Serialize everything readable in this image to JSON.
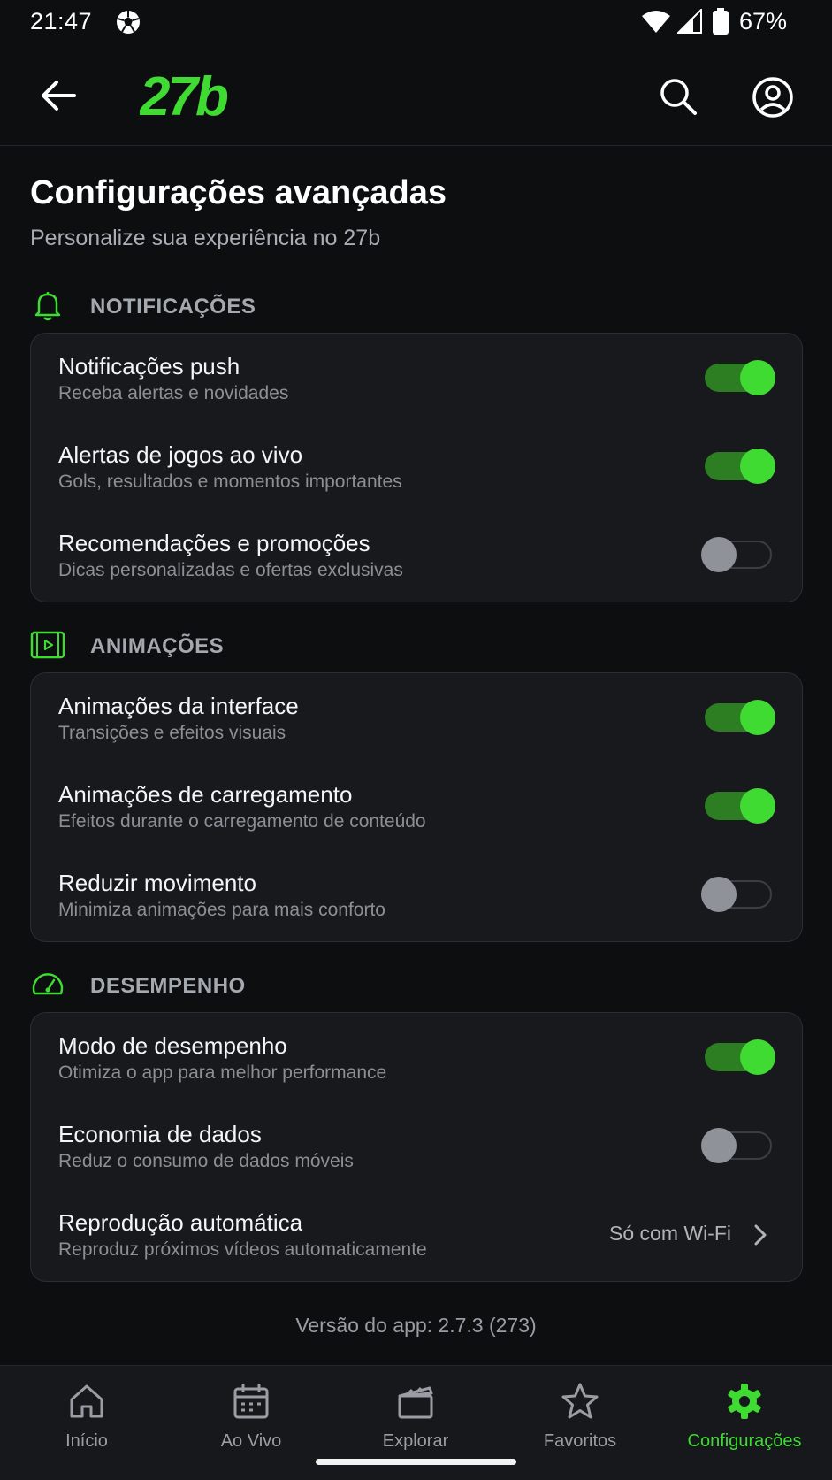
{
  "status_bar": {
    "time": "21:47",
    "battery": "67%"
  },
  "app_bar": {
    "logo_text": "27b"
  },
  "header": {
    "title": "Configurações avançadas",
    "subtitle": "Personalize sua experiência no 27b"
  },
  "sections": {
    "notifications": {
      "label": "NOTIFICAÇÕES",
      "rows": [
        {
          "title": "Notificações push",
          "desc": "Receba alertas e novidades",
          "enabled": true
        },
        {
          "title": "Alertas de jogos ao vivo",
          "desc": "Gols, resultados e momentos importantes",
          "enabled": true
        },
        {
          "title": "Recomendações e promoções",
          "desc": "Dicas personalizadas e ofertas exclusivas",
          "enabled": false
        }
      ]
    },
    "animations": {
      "label": "ANIMAÇÕES",
      "rows": [
        {
          "title": "Animações da interface",
          "desc": "Transições e efeitos visuais",
          "enabled": true
        },
        {
          "title": "Animações de carregamento",
          "desc": "Efeitos durante o carregamento de conteúdo",
          "enabled": true
        },
        {
          "title": "Reduzir movimento",
          "desc": "Minimiza animações para mais conforto",
          "enabled": false
        }
      ]
    },
    "performance": {
      "label": "DESEMPENHO",
      "rows": [
        {
          "title": "Modo de desempenho",
          "desc": "Otimiza o app para melhor performance",
          "enabled": true
        },
        {
          "title": "Economia de dados",
          "desc": "Reduz o consumo de dados móveis",
          "enabled": false
        },
        {
          "title": "Reprodução automática",
          "desc": "Reproduz próximos vídeos automaticamente",
          "value": "Só com Wi-Fi"
        }
      ]
    }
  },
  "version": "Versão do app: 2.7.3 (273)",
  "bottom_nav": {
    "items": [
      {
        "label": "Início",
        "icon": "home-icon"
      },
      {
        "label": "Ao Vivo",
        "icon": "calendar-icon"
      },
      {
        "label": "Explorar",
        "icon": "clapperboard-icon"
      },
      {
        "label": "Favoritos",
        "icon": "star-icon"
      },
      {
        "label": "Configurações",
        "icon": "gear-icon"
      }
    ],
    "active_index": 4
  },
  "colors": {
    "accent": "#3fdb33",
    "toggle_on_track": "#2d7d22",
    "background": "#0d0e10",
    "card": "#17191c"
  }
}
